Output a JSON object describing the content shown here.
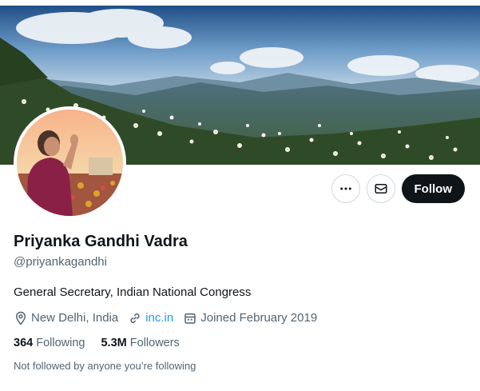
{
  "profile": {
    "name": "Priyanka Gandhi Vadra",
    "handle": "@priyankagandhi",
    "bio": "General Secretary, Indian National Congress",
    "location": "New Delhi, India",
    "website": "inc.in",
    "joined": "Joined February 2019",
    "following_count": "364",
    "following_label": "Following",
    "followers_count": "5.3M",
    "followers_label": "Followers",
    "followed_by_note": "Not followed by anyone you’re following"
  },
  "actions": {
    "more_icon": "more-horizontal-icon",
    "message_icon": "envelope-icon",
    "follow_label": "Follow"
  },
  "colors": {
    "text": "#0f1419",
    "secondary": "#536471",
    "link": "#1d9bf0",
    "follow_bg": "#0f1419",
    "border": "#cfd9de"
  }
}
